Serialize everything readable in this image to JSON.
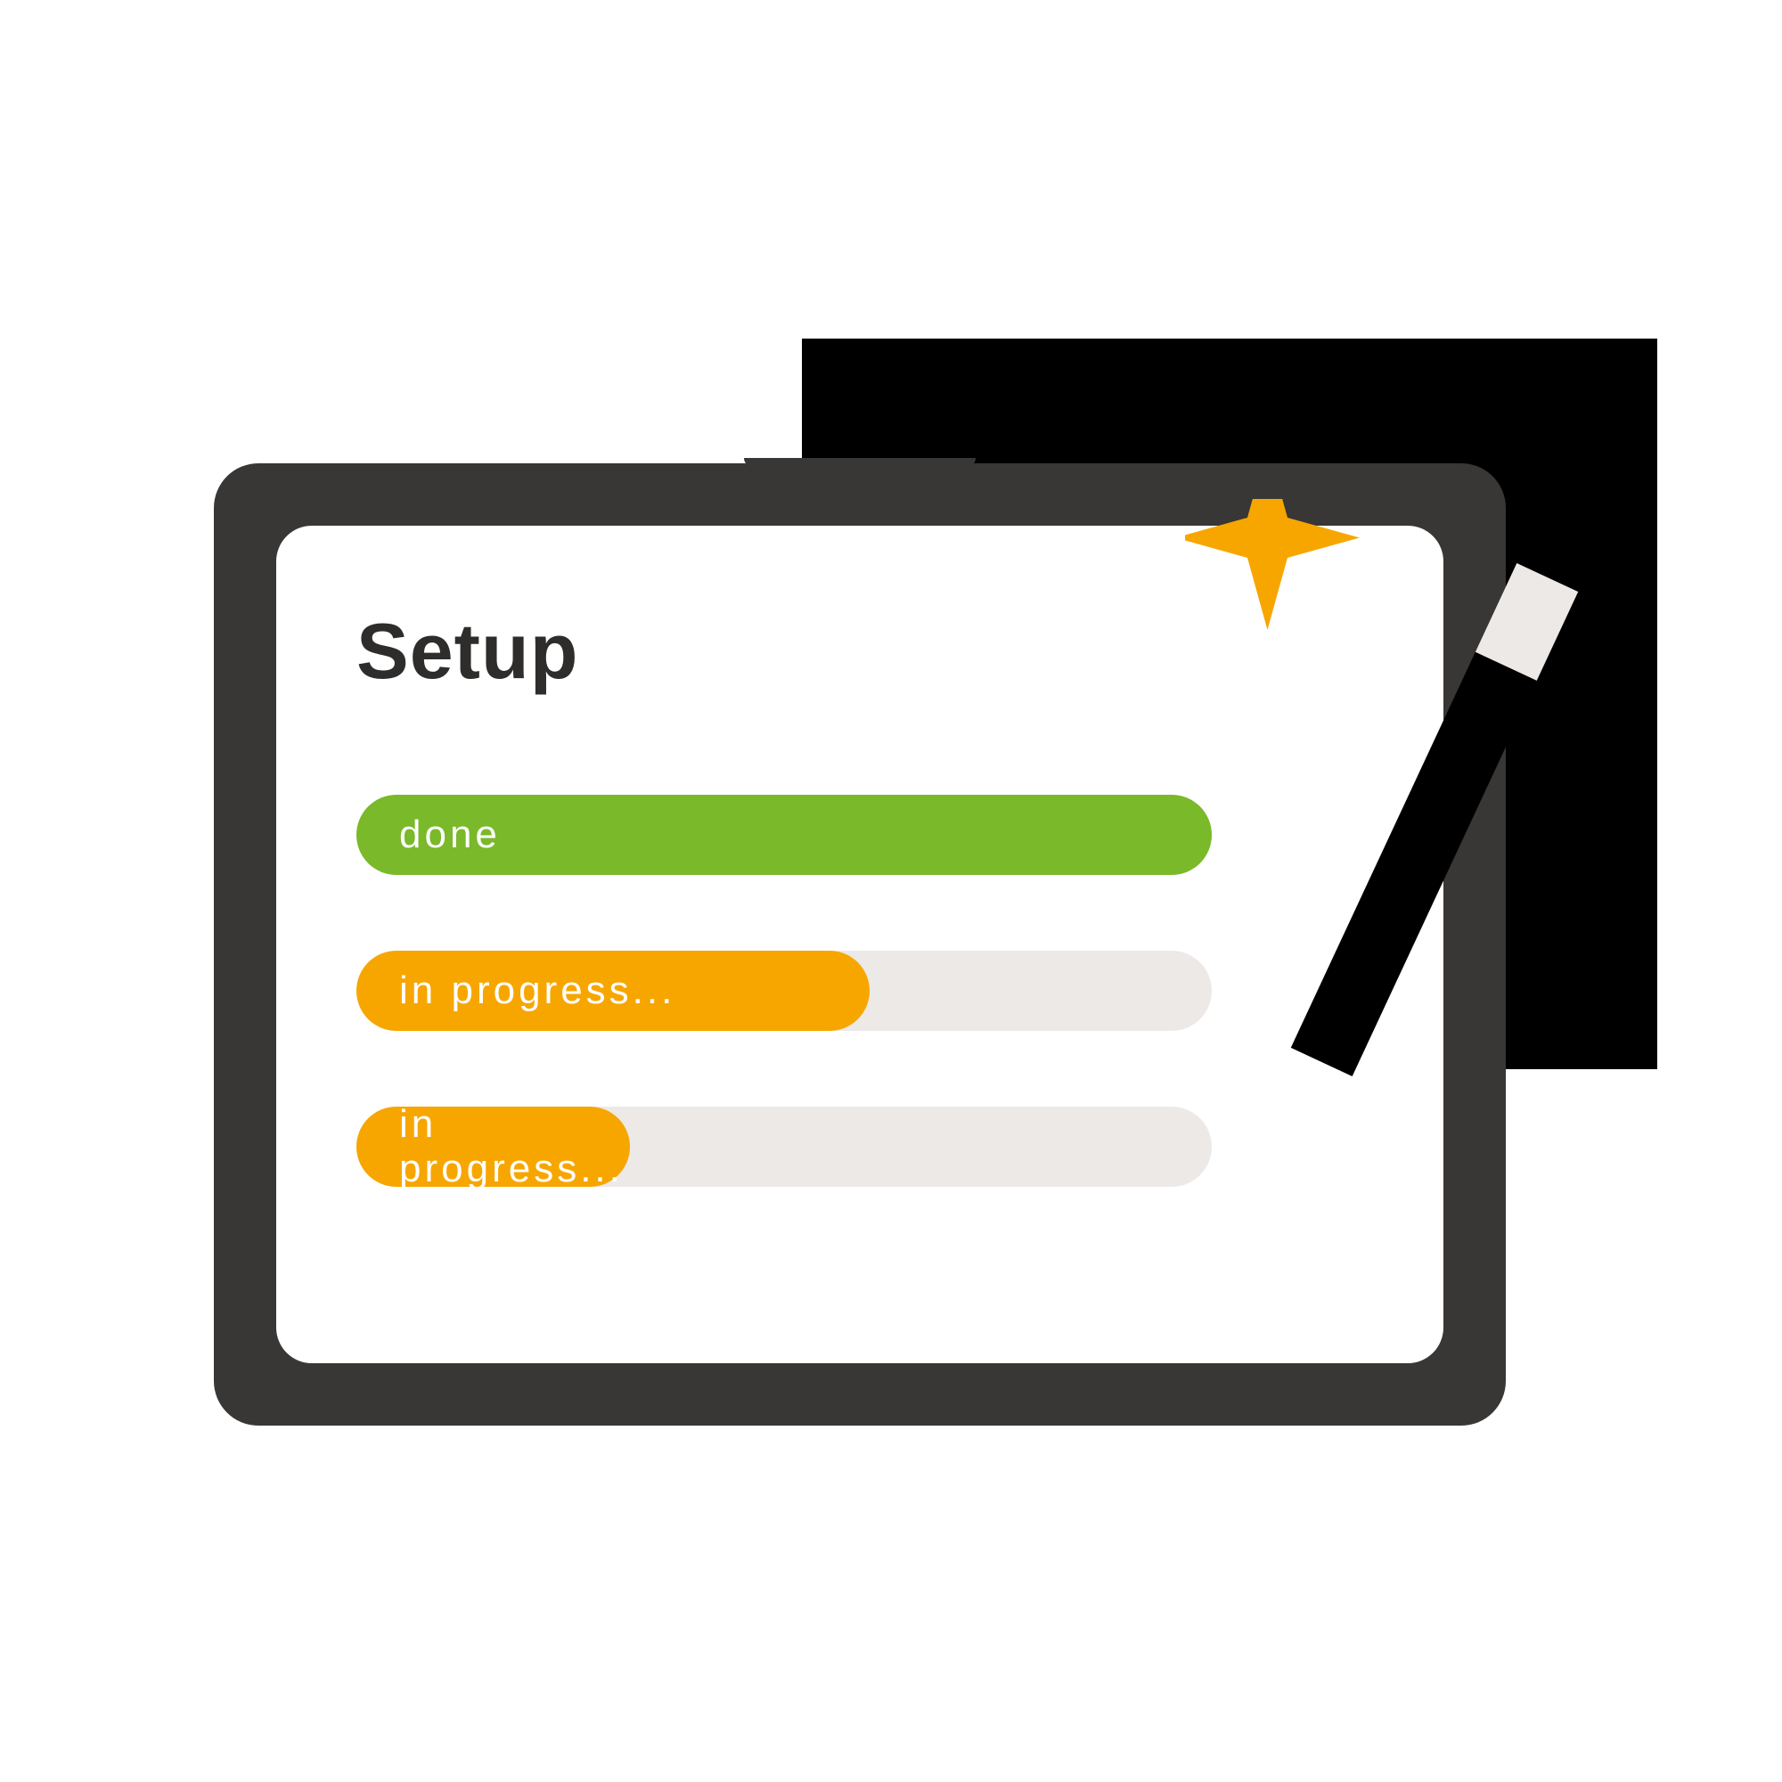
{
  "screen": {
    "title": "Setup"
  },
  "progress": [
    {
      "label": "done",
      "state": "done",
      "percent": 100
    },
    {
      "label": "in progress...",
      "state": "progress",
      "percent": 60
    },
    {
      "label": "in progress...",
      "state": "progress",
      "percent": 32
    }
  ],
  "colors": {
    "frame": "#383736",
    "back_rect": "#000000",
    "done": "#7ab929",
    "progress": "#f7a600",
    "track": "#ece9e7",
    "sparkle": "#f7a600"
  }
}
